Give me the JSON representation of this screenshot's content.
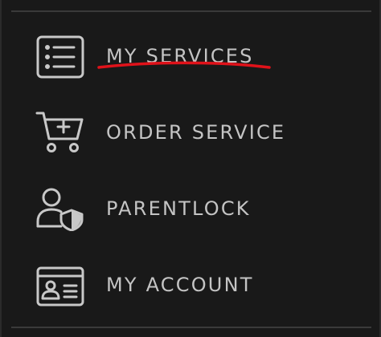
{
  "menu": {
    "items": [
      {
        "label": "MY SERVICES",
        "icon": "list-icon",
        "annotated": true
      },
      {
        "label": "ORDER SERVICE",
        "icon": "cart-plus-icon"
      },
      {
        "label": "PARENTLOCK",
        "icon": "user-shield-icon"
      },
      {
        "label": "MY ACCOUNT",
        "icon": "id-card-icon"
      }
    ]
  },
  "colors": {
    "background": "#191919",
    "text": "#c4c4c4",
    "icon": "#c8c8c8",
    "annotation": "#e0121a",
    "divider": "#3a3a3a"
  }
}
